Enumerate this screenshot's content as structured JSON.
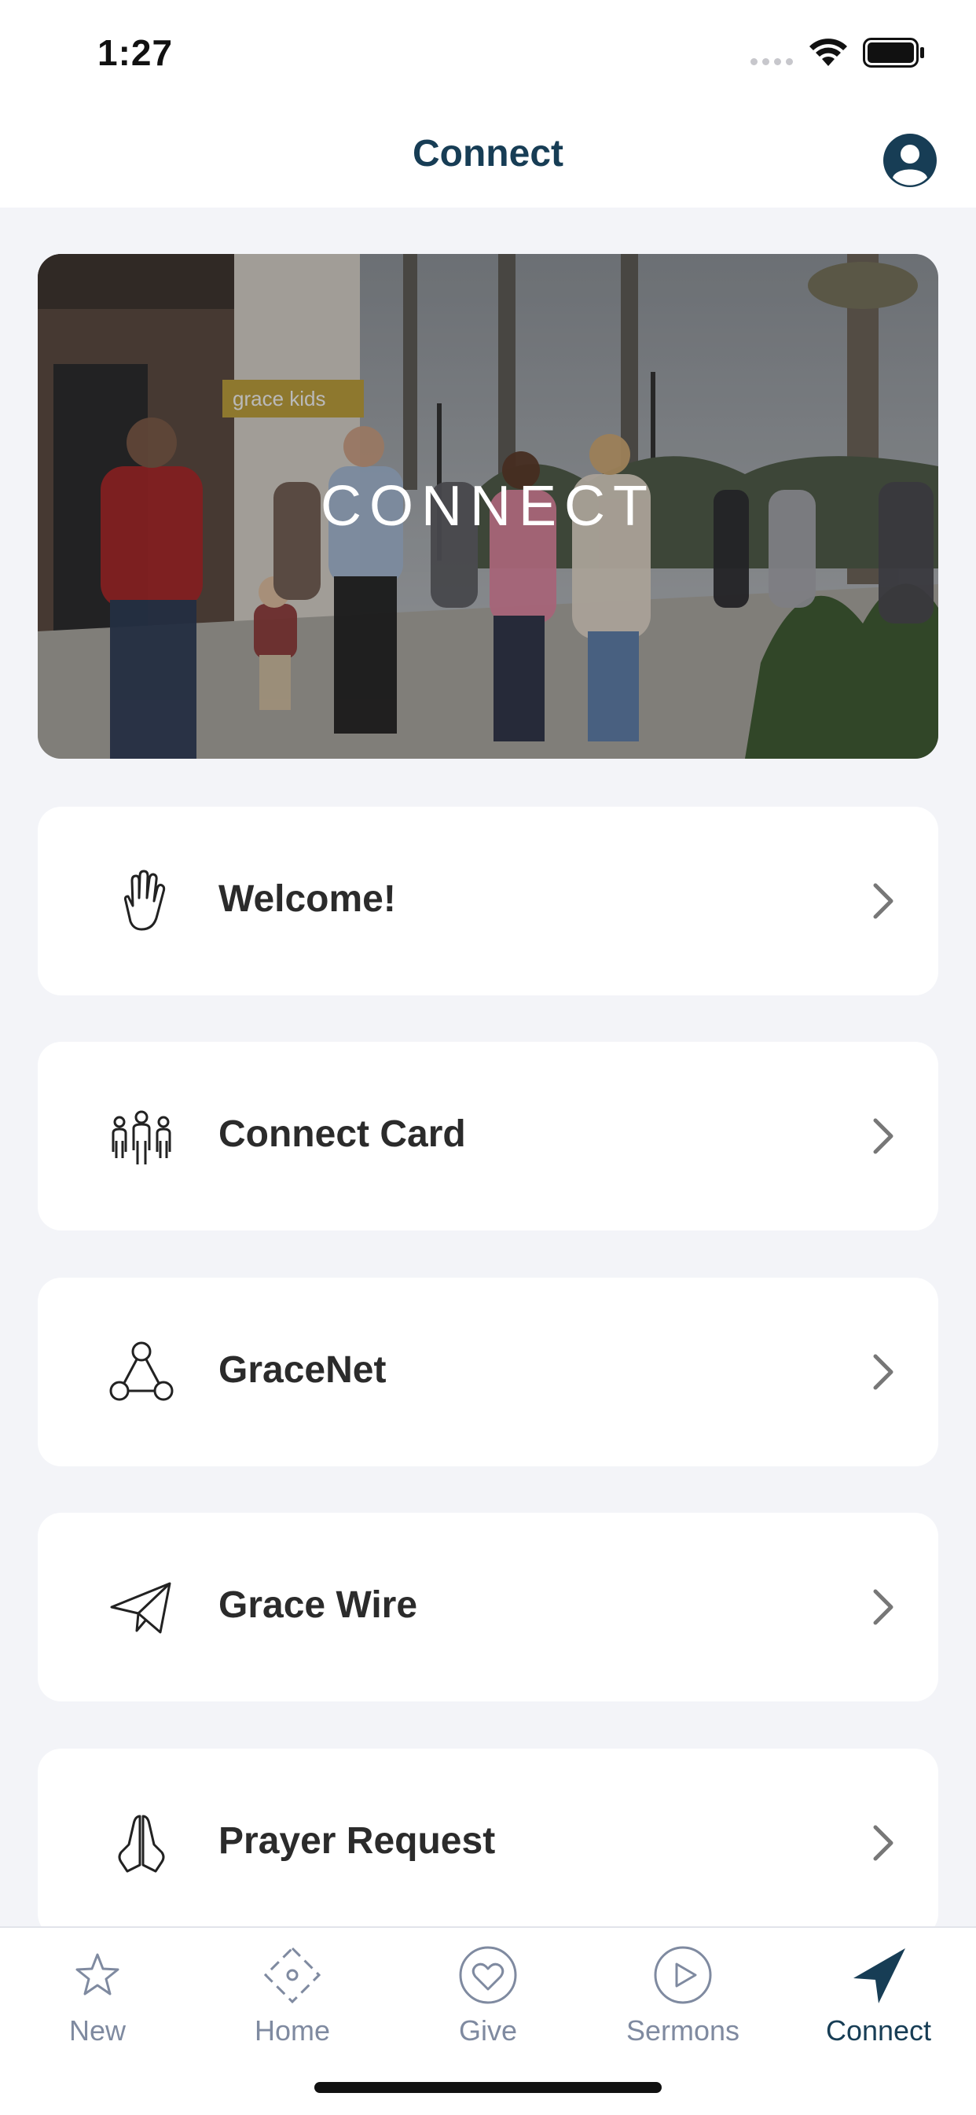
{
  "status_bar": {
    "time": "1:27"
  },
  "nav": {
    "title": "Connect",
    "profile_icon": "person-circle-icon"
  },
  "hero": {
    "title": "CONNECT",
    "sign_text": "grace kids"
  },
  "menu": [
    {
      "label": "Welcome!",
      "icon": "raised-hand-icon"
    },
    {
      "label": "Connect Card",
      "icon": "people-group-icon"
    },
    {
      "label": "GraceNet",
      "icon": "network-nodes-icon"
    },
    {
      "label": "Grace Wire",
      "icon": "paper-plane-icon"
    },
    {
      "label": "Prayer Request",
      "icon": "praying-hands-icon"
    }
  ],
  "tabs": [
    {
      "label": "New",
      "icon": "star-icon",
      "active": false
    },
    {
      "label": "Home",
      "icon": "home-diamond-icon",
      "active": false
    },
    {
      "label": "Give",
      "icon": "heart-circle-icon",
      "active": false
    },
    {
      "label": "Sermons",
      "icon": "play-circle-icon",
      "active": false
    },
    {
      "label": "Connect",
      "icon": "navigation-arrow-icon",
      "active": true
    }
  ],
  "colors": {
    "accent": "#173d55",
    "inactive": "#7f8aa0",
    "background": "#f3f4f8"
  }
}
